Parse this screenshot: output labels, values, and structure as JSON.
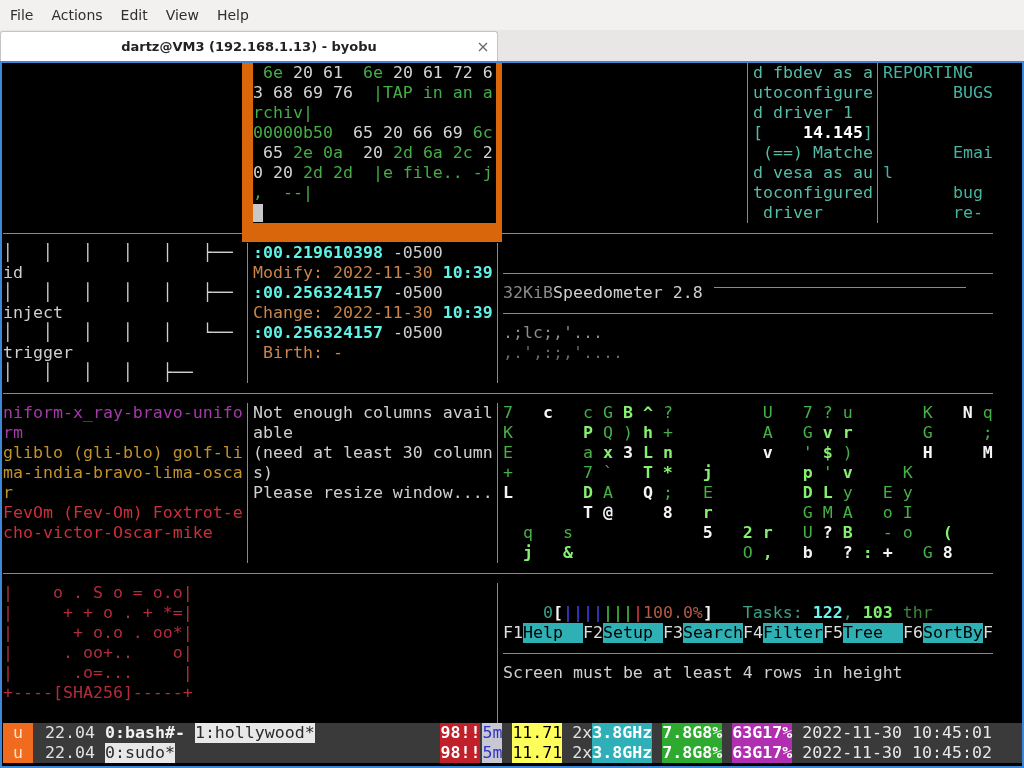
{
  "menu_bar": [
    "File",
    "Actions",
    "Edit",
    "View",
    "Help"
  ],
  "tab": {
    "title": "dartz@VM3 (192.168.1.13) - byobu",
    "selected": true
  },
  "panes": {
    "hexdump": {
      "cursor": true,
      "lines": [
        [
          {
            "text": " 6e",
            "color": "#45ad45"
          },
          {
            "text": " 20 61",
            "color": "#d4d4d4"
          },
          {
            "text": "  6e",
            "color": "#45ad45"
          },
          {
            "text": " 20 61 72 6",
            "color": "#d4d4d4"
          }
        ],
        [
          {
            "text": "3 68 69 76",
            "color": "#d4d4d4"
          },
          {
            "text": "  |TAP in an a",
            "color": "#45ad45"
          }
        ],
        [
          {
            "text": "rchiv|",
            "color": "#45ad45"
          }
        ],
        [
          {
            "text": "00000b50",
            "color": "#45ad45"
          },
          {
            "text": "  65 20 66 69",
            "color": "#d4d4d4"
          },
          {
            "text": " 6c",
            "color": "#45ad45"
          }
        ],
        [
          {
            "text": " 65",
            "color": "#d4d4d4"
          },
          {
            "text": " 2e 0a",
            "color": "#45ad45"
          },
          {
            "text": "  20",
            "color": "#d4d4d4"
          },
          {
            "text": " 2d 6a 2c",
            "color": "#45ad45"
          },
          {
            "text": " 2",
            "color": "#d4d4d4"
          }
        ],
        [
          {
            "text": "0 20",
            "color": "#d4d4d4"
          },
          {
            "text": " 2d 2d  |e file.. -j",
            "color": "#45ad45"
          }
        ],
        [
          {
            "text": ",  --|",
            "color": "#45ad45"
          }
        ]
      ]
    },
    "dmesg": {
      "lines": [
        [
          {
            "text": "d fbdev as a",
            "color": "#55bba5"
          }
        ],
        [
          {
            "text": "utoconfigure",
            "color": "#55bba5"
          }
        ],
        [
          {
            "text": "d driver 1",
            "color": "#55bba5"
          }
        ],
        [
          {
            "text": "[",
            "color": "#55bba5"
          },
          {
            "text": "    14.145",
            "color": "#ffffff",
            "bold": true
          },
          {
            "text": "]",
            "color": "#55bba5"
          }
        ],
        [
          {
            "text": " (==) Matche",
            "color": "#55bba5"
          }
        ],
        [
          {
            "text": "d vesa as au",
            "color": "#55bba5"
          }
        ],
        [
          {
            "text": "toconfigured",
            "color": "#55bba5"
          }
        ],
        [
          {
            "text": " driver",
            "color": "#55bba5"
          }
        ]
      ]
    },
    "manual": {
      "heading": [
        "REPORTING",
        "       BUGS"
      ],
      "body": [
        "       Emai",
        "l",
        "       bug",
        "       re-"
      ]
    },
    "tree": {
      "lines": [
        "│   │   │   │   │   ├──",
        "id",
        "│   │   │   │   │   ├──",
        "inject",
        "│   │   │   │   │   └──",
        "trigger",
        "│   │   │   │   ├──"
      ]
    },
    "stat": {
      "lines": [
        [
          {
            "text": ":00.219610398",
            "color": "#5ff2e6",
            "bold": true
          },
          {
            "text": " -0500",
            "color": "#cccccc"
          }
        ],
        [
          {
            "text": "Modify: 2022-11-30",
            "color": "#c9854a"
          },
          {
            "text": " 10:39",
            "color": "#5ff2e6",
            "bold": true
          }
        ],
        [
          {
            "text": ":00.256324157",
            "color": "#5ff2e6",
            "bold": true
          },
          {
            "text": " -0500",
            "color": "#cccccc"
          }
        ],
        [
          {
            "text": "Change: 2022-11-30",
            "color": "#c9854a"
          },
          {
            "text": " 10:39",
            "color": "#5ff2e6",
            "bold": true
          }
        ],
        [
          {
            "text": ":00.256324157",
            "color": "#5ff2e6",
            "bold": true
          },
          {
            "text": " -0500",
            "color": "#cccccc"
          }
        ],
        [
          {
            "text": " Birth: -",
            "color": "#c9854a"
          }
        ]
      ]
    },
    "speedometer": {
      "unit": "32KiB",
      "title": "Speedometer 2.8",
      "trace": [
        [
          {
            "text": ".;lc;,'...",
            "color": "#8c8c8c"
          }
        ],
        [
          {
            "text": ",.',:;,'....",
            "color": "#686868"
          }
        ]
      ]
    },
    "words": {
      "entries": [
        {
          "color": "#a23aa8",
          "lines": [
            "niform-x_ray-bravo-unifo",
            "rm"
          ]
        },
        {
          "color": "#c2922a",
          "lines": [
            "gliblo (gli-blo) golf-li",
            "ma-india-bravo-lima-osca",
            "r"
          ]
        },
        {
          "color": "#cc2f3a",
          "lines": [
            "FevOm (Fev-Om) Foxtrot-e",
            "cho-victor-Oscar-mike"
          ]
        }
      ]
    },
    "notice": {
      "lines": [
        "Not enough columns avail",
        "able",
        "(need at least 30 column",
        "s)",
        "Please resize window...."
      ]
    },
    "matrix": {
      "lines": [
        [
          {
            "text": "7",
            "color": "#45b045"
          },
          {
            "text": "   c",
            "color": "#f4f4f4",
            "bold": true
          },
          {
            "text": "   c G",
            "color": "#45b045"
          },
          {
            "text": " B ^",
            "color": "#86f070",
            "bold": true
          },
          {
            "text": " ?         U   7 ? u       K",
            "color": "#45b045"
          },
          {
            "text": "   N",
            "color": "#f4f4f4",
            "bold": true
          },
          {
            "text": " q",
            "color": "#45b045"
          }
        ],
        [
          {
            "text": "K",
            "color": "#45b045"
          },
          {
            "text": "       P",
            "color": "#86f070",
            "bold": true
          },
          {
            "text": " Q )",
            "color": "#45b045"
          },
          {
            "text": " h",
            "color": "#86f070",
            "bold": true
          },
          {
            "text": " +         A   G",
            "color": "#45b045"
          },
          {
            "text": " v r",
            "color": "#86f070",
            "bold": true
          },
          {
            "text": "       G     ;",
            "color": "#45b045"
          }
        ],
        [
          {
            "text": "E       a",
            "color": "#45b045"
          },
          {
            "text": " x",
            "color": "#86f070",
            "bold": true
          },
          {
            "text": " 3",
            "color": "#f4f4f4",
            "bold": true
          },
          {
            "text": " L n",
            "color": "#86f070",
            "bold": true
          },
          {
            "text": "         v",
            "color": "#f4f4f4",
            "bold": true
          },
          {
            "text": "   '",
            "color": "#45b045"
          },
          {
            "text": " $",
            "color": "#86f070",
            "bold": true
          },
          {
            "text": " )",
            "color": "#45b045"
          },
          {
            "text": "       H     M",
            "color": "#f4f4f4",
            "bold": true
          }
        ],
        [
          {
            "text": "+       7 `",
            "color": "#45b045"
          },
          {
            "text": "   T *   j         p",
            "color": "#86f070",
            "bold": true
          },
          {
            "text": " '",
            "color": "#45b045"
          },
          {
            "text": " v",
            "color": "#86f070",
            "bold": true
          },
          {
            "text": "     K",
            "color": "#45b045"
          }
        ],
        [
          {
            "text": "L",
            "color": "#f4f4f4",
            "bold": true
          },
          {
            "text": "       D",
            "color": "#86f070",
            "bold": true
          },
          {
            "text": " A",
            "color": "#45b045"
          },
          {
            "text": "   Q",
            "color": "#f4f4f4",
            "bold": true
          },
          {
            "text": " ;   E",
            "color": "#45b045"
          },
          {
            "text": "         D L",
            "color": "#86f070",
            "bold": true
          },
          {
            "text": " y   E y",
            "color": "#45b045"
          }
        ],
        [
          {
            "text": "        T @     8",
            "color": "#f4f4f4",
            "bold": true
          },
          {
            "text": "   r",
            "color": "#86f070",
            "bold": true
          },
          {
            "text": "         G M A   o I",
            "color": "#45b045"
          }
        ],
        [
          {
            "text": "  q   s",
            "color": "#45b045"
          },
          {
            "text": "             5",
            "color": "#f4f4f4",
            "bold": true
          },
          {
            "text": "   2 r",
            "color": "#86f070",
            "bold": true
          },
          {
            "text": "   U",
            "color": "#45b045"
          },
          {
            "text": " ?",
            "color": "#f4f4f4",
            "bold": true
          },
          {
            "text": " B",
            "color": "#86f070",
            "bold": true
          },
          {
            "text": "   - o",
            "color": "#45b045"
          },
          {
            "text": "   (",
            "color": "#86f070",
            "bold": true
          }
        ],
        [
          {
            "text": "  j   &",
            "color": "#86f070",
            "bold": true
          },
          {
            "text": "                 O",
            "color": "#45b045"
          },
          {
            "text": " ,",
            "color": "#86f070",
            "bold": true
          },
          {
            "text": "   b   ?",
            "color": "#f4f4f4",
            "bold": true
          },
          {
            "text": " :",
            "color": "#86f070",
            "bold": true
          },
          {
            "text": " +",
            "color": "#f4f4f4",
            "bold": true
          },
          {
            "text": "   G",
            "color": "#45b045"
          },
          {
            "text": " 8",
            "color": "#f4f4f4",
            "bold": true
          }
        ]
      ]
    },
    "randomart": {
      "lines": [
        "|    o . S o = o.o|",
        "|     + + o . + *=|",
        "|      + o.o . oo*|",
        "|     . oo+..    o|",
        "|      .o=...     |",
        "+----[SHA256]-----+"
      ]
    },
    "htop": {
      "cpu_meter": [
        {
          "text": "    0",
          "color": "#3aa08a"
        },
        {
          "text": "[",
          "color": "#f4f4f4",
          "bold": true
        },
        {
          "text": "||||",
          "color": "#3434c4",
          "bold": true
        },
        {
          "text": "|||",
          "color": "#34a834",
          "bold": true
        },
        {
          "text": "|",
          "color": "#b83030",
          "bold": true
        },
        {
          "text": "100.0%",
          "color": "#b45a42"
        },
        {
          "text": "]",
          "color": "#f4f4f4",
          "bold": true
        },
        {
          "text": "   Tasks:",
          "color": "#3aa08a"
        },
        {
          "text": " 122",
          "color": "#6ff4f0",
          "bold": true
        },
        {
          "text": ",",
          "color": "#3aa08a"
        },
        {
          "text": " 103",
          "color": "#7cf06a",
          "bold": true
        },
        {
          "text": " thr",
          "color": "#3a8a3a"
        }
      ],
      "function_keys": [
        {
          "key": "F1",
          "label": "Help"
        },
        {
          "key": "F2",
          "label": "Setup"
        },
        {
          "key": "F3",
          "label": "Search"
        },
        {
          "key": "F4",
          "label": "Filter"
        },
        {
          "key": "F5",
          "label": "Tree"
        },
        {
          "key": "F6",
          "label": "SortBy"
        },
        {
          "key": "F"
        }
      ],
      "message": "Screen must be at least 4 rows in height"
    }
  },
  "status_lines": [
    {
      "badge": "u",
      "release": "22.04",
      "windows": [
        {
          "label": "0:bash#-",
          "selected": false
        },
        {
          "label": "1:hollywood*",
          "selected": true
        }
      ],
      "indicators": [
        {
          "kind": "alert",
          "text": "98!!"
        },
        {
          "kind": "uptime",
          "text": "5m"
        },
        {
          "kind": "load",
          "text": "11.71"
        },
        {
          "kind": "count",
          "text": "2x"
        },
        {
          "kind": "cpu",
          "text": "3.8GHz"
        },
        {
          "kind": "memory",
          "text": "7.8G8%"
        },
        {
          "kind": "disk",
          "text": "63G17%"
        }
      ],
      "clock": "2022-11-30 10:45:01"
    },
    {
      "badge": "u",
      "release": "22.04",
      "windows": [
        {
          "label": "0:sudo*",
          "selected": true
        }
      ],
      "indicators": [
        {
          "kind": "alert",
          "text": "98!!"
        },
        {
          "kind": "uptime",
          "text": "5m"
        },
        {
          "kind": "load",
          "text": "11.71"
        },
        {
          "kind": "count",
          "text": "2x"
        },
        {
          "kind": "cpu",
          "text": "3.8GHz"
        },
        {
          "kind": "memory",
          "text": "7.8G8%"
        },
        {
          "kind": "disk",
          "text": "63G17%"
        }
      ],
      "clock": "2022-11-30 10:45:02"
    }
  ]
}
